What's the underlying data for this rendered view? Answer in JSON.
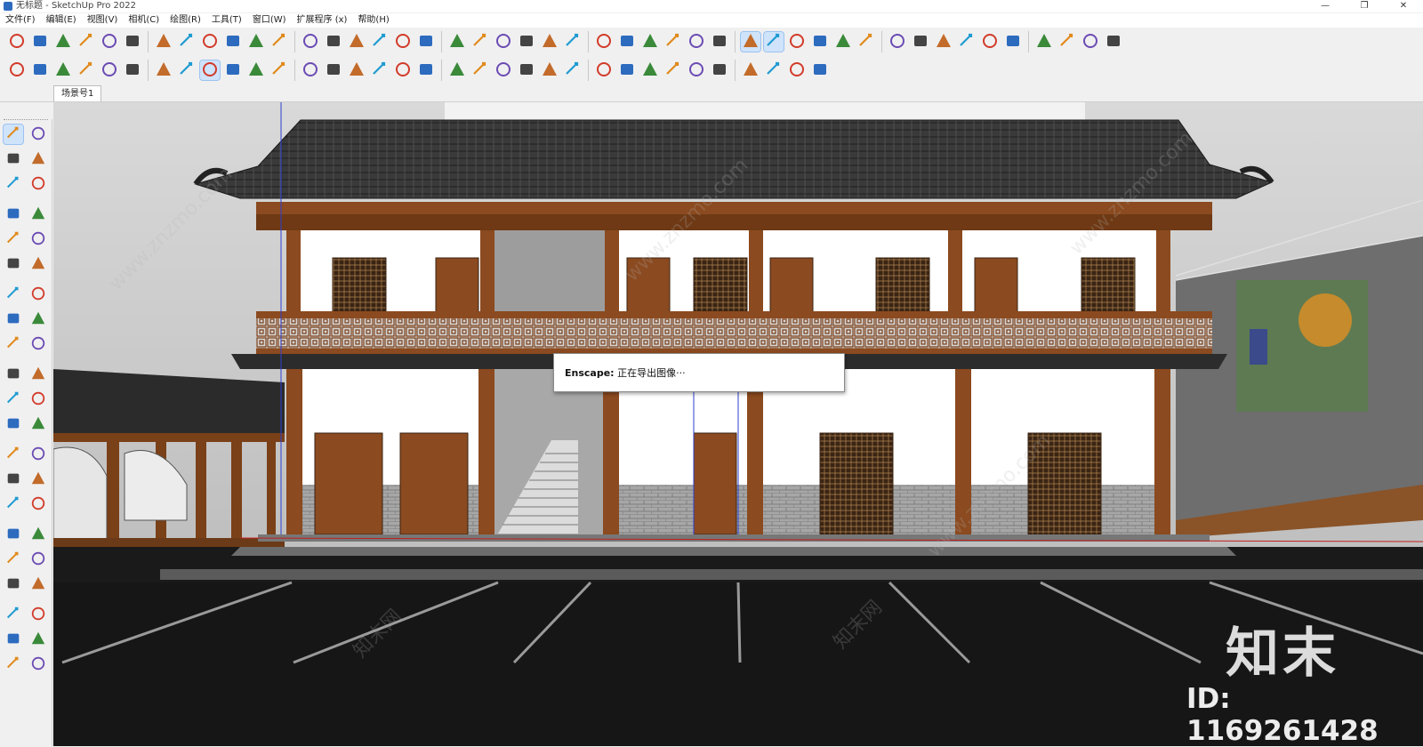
{
  "window": {
    "title": "无标题 - SketchUp Pro 2022",
    "controls": [
      "—",
      "❐",
      "✕"
    ]
  },
  "menu": [
    "文件(F)",
    "编辑(E)",
    "视图(V)",
    "相机(C)",
    "绘图(R)",
    "工具(T)",
    "窗口(W)",
    "扩展程序 (x)",
    "帮助(H)"
  ],
  "scene_tab": "场景号1",
  "dialog": {
    "app": "Enscape:",
    "message": "正在导出图像···"
  },
  "watermark": {
    "logo": "知末",
    "id": "ID: 1169261428",
    "diagonal": "www.znzmo.com",
    "diagonal_cn": "知末网"
  },
  "colors": {
    "accent": "#cfe3fb",
    "wood": "#8b4a1f",
    "roof": "#2e2e2e",
    "wall": "#ffffff",
    "ground": "#1c1c1c"
  },
  "toolbar_row1_icons": [
    "new-icon",
    "open-icon",
    "save-icon",
    "cut-icon",
    "copy-icon",
    "paste-icon",
    "erase-icon",
    "undo-icon",
    "redo-icon",
    "print-icon",
    "model-info-icon",
    "enscape-start-icon",
    "enscape-sync-icon",
    "enscape-video-icon",
    "add-icon",
    "tree-icon",
    "sun-icon",
    "checker-icon",
    "upload-icon",
    "settings-icon",
    "mail-icon",
    "info-icon",
    "user-icon",
    "layer-icon",
    "grid-icon",
    "solid-icon",
    "plugin-icon",
    "box-icon",
    "cloud-icon",
    "cloud-share-icon",
    "cloud-link-icon",
    "cloud-edit-icon",
    "resize-icon",
    "gear2-icon",
    "check-icon",
    "download-icon",
    "cog-icon",
    "cube-icon",
    "chrome-icon",
    "pencil-icon",
    "dimension-icon",
    "paint-icon",
    "tape-icon",
    "book-icon",
    "layers-icon",
    "sandbox-icon"
  ],
  "toolbar_row2_icons": [
    "orbit-icon",
    "pan-icon",
    "zoom-icon",
    "zoom-window-icon",
    "zoom-extents-icon",
    "walk-icon",
    "look-around-icon",
    "footprint-icon",
    "select-icon",
    "component-icon",
    "paint-bucket-icon",
    "eraser-icon",
    "section-icon",
    "iso-icon",
    "top-icon",
    "front-icon",
    "right-icon",
    "back-icon",
    "axes-icon",
    "xray-icon",
    "wireframe-icon",
    "hidden-line-icon",
    "house-icon",
    "house2-icon",
    "house3-icon",
    "house4-icon",
    "shaded-icon",
    "textured-icon",
    "monochrome-icon",
    "face-icon",
    "edge-icon",
    "style1-icon",
    "style2-icon",
    "style3-icon"
  ],
  "left_tools": [
    "select-icon",
    "orbit-icon",
    "paint-icon",
    "eraser-icon",
    "component-icon",
    "tag-icon",
    "line-icon",
    "freehand-icon",
    "rectangle-icon",
    "rotated-rect-icon",
    "circle-icon",
    "polygon-icon",
    "arc-icon",
    "arc2-icon",
    "pie-icon",
    "arc3-icon",
    "move-icon",
    "push-pull-icon",
    "rotate-icon",
    "follow-me-icon",
    "scale-icon",
    "offset-icon",
    "tape-icon",
    "dimension-icon",
    "protractor-icon",
    "text-icon",
    "axes-icon",
    "3dtext-icon",
    "orbit2-icon",
    "pan-icon",
    "zoom-icon",
    "zoom-window-icon",
    "zoom-extents-icon",
    "previous-view-icon",
    "walk-icon",
    "look-around-icon",
    "footprint-icon",
    "position-camera-icon",
    "sandbox-icon",
    "smoove-icon",
    "stamp-icon",
    "drape-icon"
  ]
}
